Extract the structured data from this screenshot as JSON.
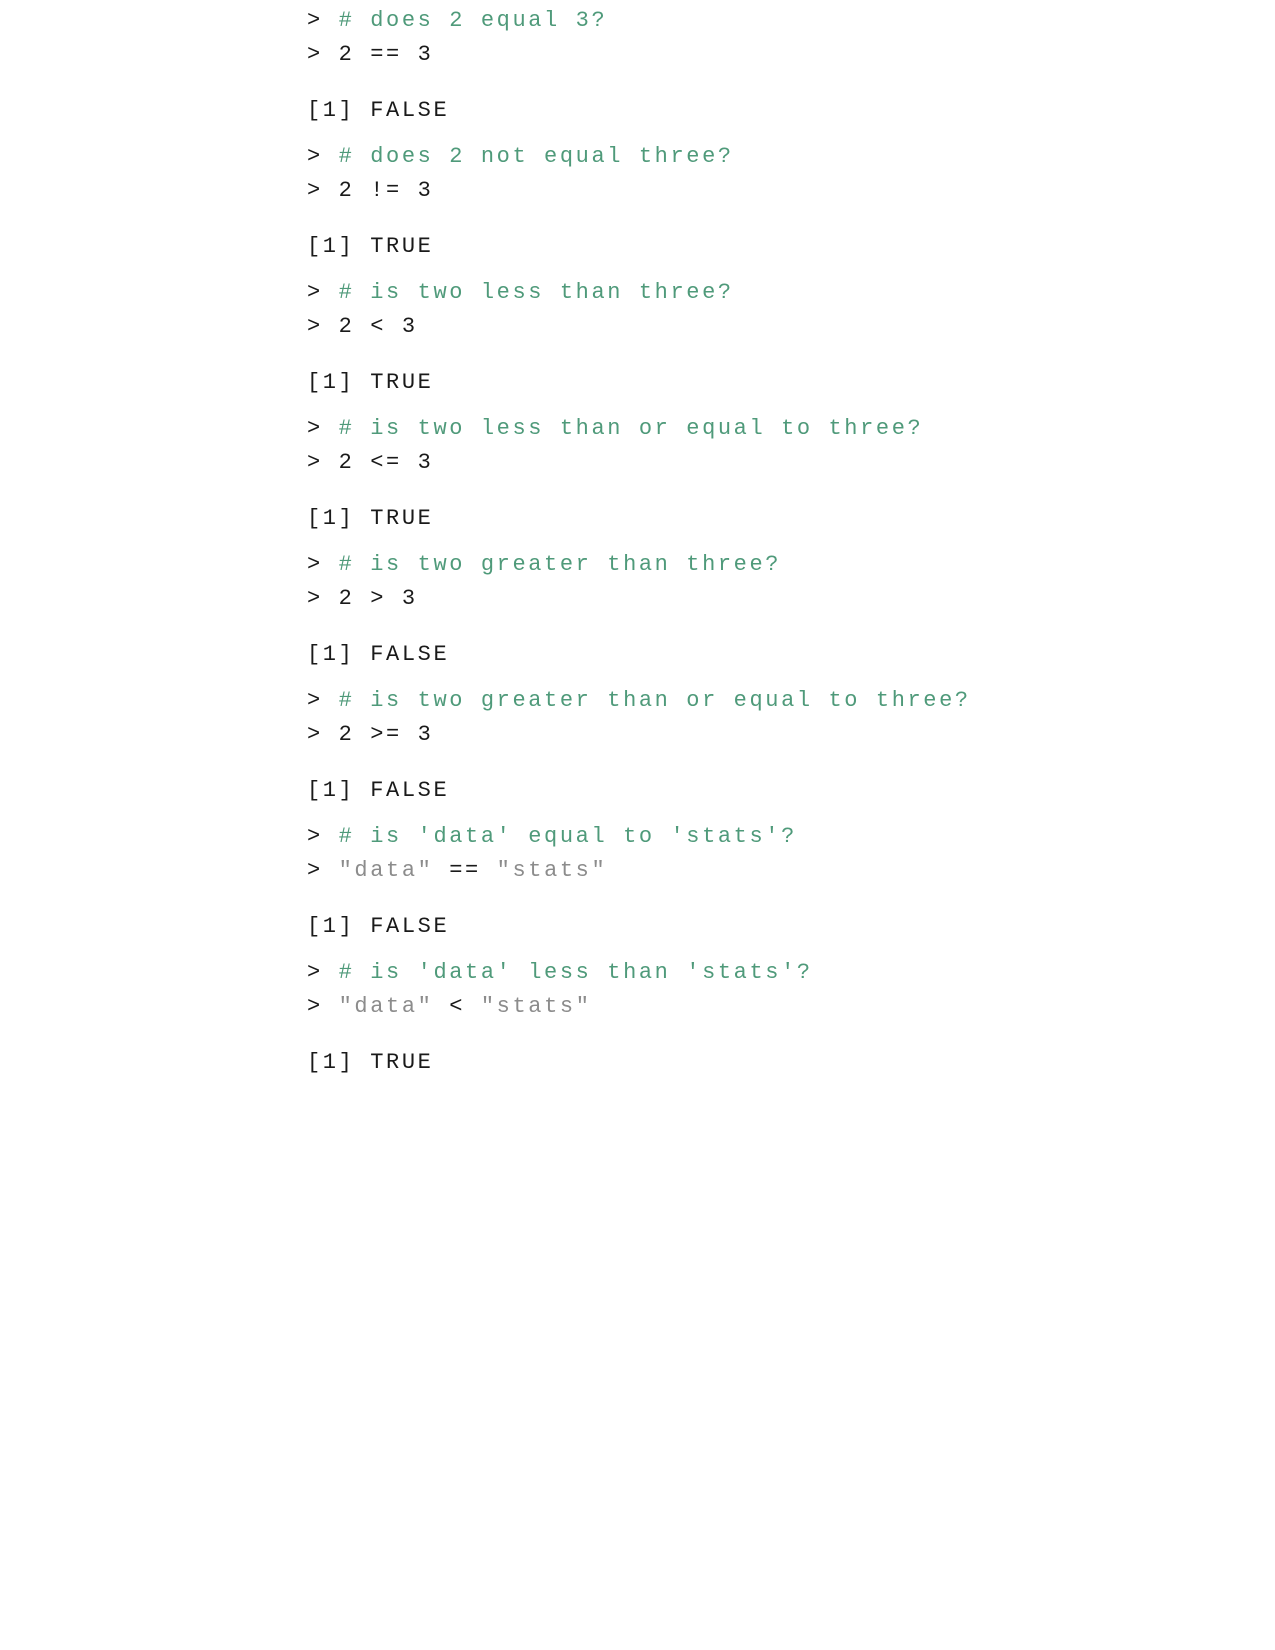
{
  "console": {
    "prompt": ">",
    "blocks": [
      {
        "comment": "# does 2 equal 3?",
        "code": [
          {
            "t": "2 == 3",
            "k": "code"
          }
        ],
        "output_index": "[1]",
        "output_value": "FALSE"
      },
      {
        "comment": "# does 2 not equal three?",
        "code": [
          {
            "t": "2 != 3",
            "k": "code"
          }
        ],
        "output_index": "[1]",
        "output_value": "TRUE"
      },
      {
        "comment": "# is two less than three?",
        "code": [
          {
            "t": "2 < 3",
            "k": "code"
          }
        ],
        "output_index": "[1]",
        "output_value": "TRUE"
      },
      {
        "comment": "# is two less than or equal to three?",
        "code": [
          {
            "t": "2 <= 3",
            "k": "code"
          }
        ],
        "output_index": "[1]",
        "output_value": "TRUE"
      },
      {
        "comment": "# is two greater than three?",
        "code": [
          {
            "t": "2 > 3",
            "k": "code"
          }
        ],
        "output_index": "[1]",
        "output_value": "FALSE"
      },
      {
        "comment": "# is two greater than or equal to three?",
        "code": [
          {
            "t": "2 >= 3",
            "k": "code"
          }
        ],
        "output_index": "[1]",
        "output_value": "FALSE"
      },
      {
        "comment": "# is 'data' equal to 'stats'?",
        "code": [
          {
            "t": "\"data\"",
            "k": "str"
          },
          {
            "t": " == ",
            "k": "code"
          },
          {
            "t": "\"stats\"",
            "k": "str"
          }
        ],
        "output_index": "[1]",
        "output_value": "FALSE"
      },
      {
        "comment": "# is 'data' less than 'stats'?",
        "code": [
          {
            "t": "\"data\"",
            "k": "str"
          },
          {
            "t": " < ",
            "k": "code"
          },
          {
            "t": "\"stats\"",
            "k": "str"
          }
        ],
        "output_index": "[1]",
        "output_value": "TRUE"
      }
    ]
  },
  "colors": {
    "comment": "#4f9a7a",
    "code": "#1a1a1a",
    "string": "#8c8c8c",
    "background": "#ffffff"
  }
}
